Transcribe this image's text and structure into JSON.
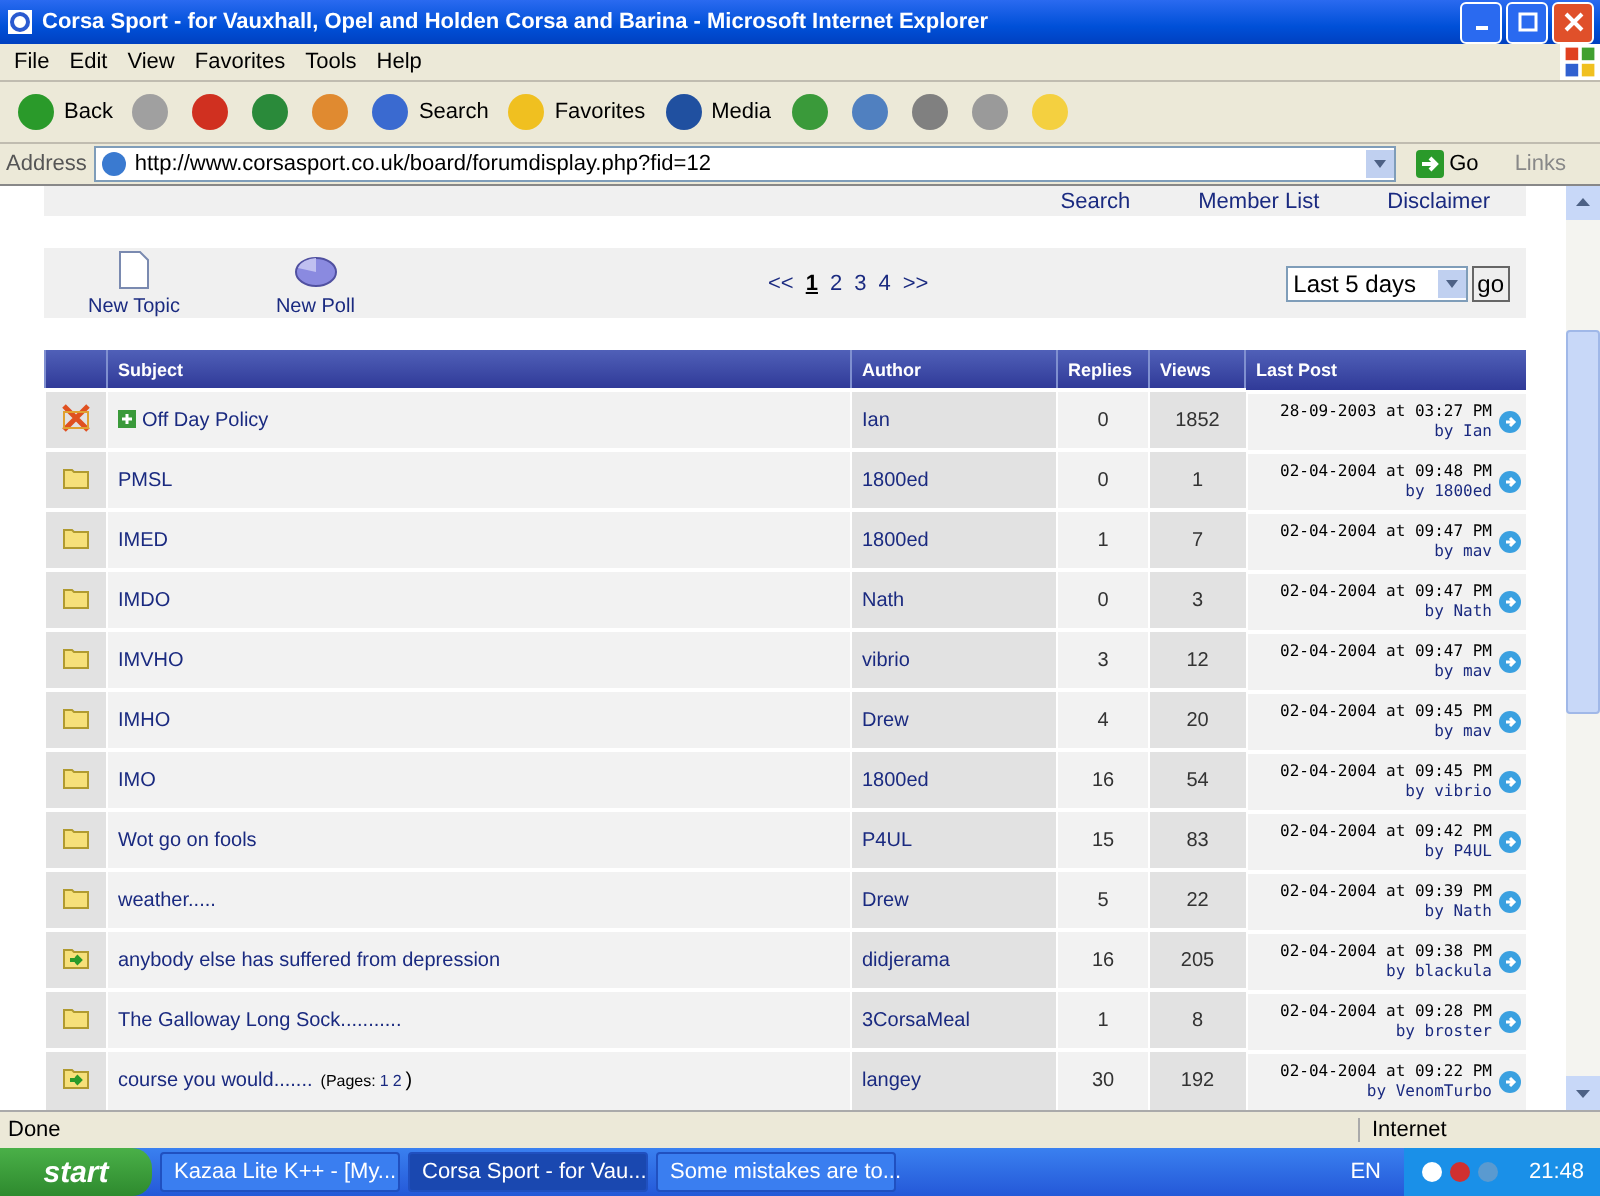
{
  "window": {
    "title": "Corsa Sport - for Vauxhall, Opel and Holden Corsa and Barina - Microsoft Internet Explorer"
  },
  "menu": [
    "File",
    "Edit",
    "View",
    "Favorites",
    "Tools",
    "Help"
  ],
  "toolbar": [
    {
      "kind": "back",
      "label": "Back"
    },
    {
      "kind": "forward"
    },
    {
      "kind": "stop"
    },
    {
      "kind": "refresh"
    },
    {
      "kind": "home"
    },
    {
      "kind": "search",
      "label": "Search"
    },
    {
      "kind": "favorites",
      "label": "Favorites"
    },
    {
      "kind": "media",
      "label": "Media"
    },
    {
      "kind": "history"
    },
    {
      "kind": "mail"
    },
    {
      "kind": "print"
    },
    {
      "kind": "edit"
    },
    {
      "kind": "note"
    }
  ],
  "address": {
    "label": "Address",
    "url": "http://www.corsasport.co.uk/board/forumdisplay.php?fid=12",
    "go": "Go",
    "links": "Links"
  },
  "top_links": [
    "Search",
    "Member List",
    "Disclaimer"
  ],
  "actions": [
    {
      "kind": "topic",
      "label": "New Topic"
    },
    {
      "kind": "poll",
      "label": "New Poll"
    }
  ],
  "pagination": {
    "prev": "<<",
    "next": ">>",
    "pages": [
      {
        "label": "1",
        "selected": true
      },
      {
        "label": "2",
        "selected": false
      },
      {
        "label": "3",
        "selected": false
      },
      {
        "label": "4",
        "selected": false
      }
    ]
  },
  "filter": {
    "value": "Last 5 days",
    "button": "go"
  },
  "table": {
    "columns": [
      "Subject",
      "Author",
      "Replies",
      "Views",
      "Last Post"
    ],
    "rows": [
      {
        "kind": "closed",
        "sticky": true,
        "subject": "Off Day Policy",
        "author": "Ian",
        "replies": "0",
        "views": "1852",
        "date": "28-09-2003 at 03:27 PM",
        "last_by": "by Ian"
      },
      {
        "kind": "normal",
        "sticky": false,
        "subject": "PMSL",
        "author": "1800ed",
        "replies": "0",
        "views": "1",
        "date": "02-04-2004 at 09:48 PM",
        "last_by": "by 1800ed"
      },
      {
        "kind": "normal",
        "sticky": false,
        "subject": "IMED",
        "author": "1800ed",
        "replies": "1",
        "views": "7",
        "date": "02-04-2004 at 09:47 PM",
        "last_by": "by mav"
      },
      {
        "kind": "normal",
        "sticky": false,
        "subject": "IMDO",
        "author": "Nath",
        "replies": "0",
        "views": "3",
        "date": "02-04-2004 at 09:47 PM",
        "last_by": "by Nath"
      },
      {
        "kind": "normal",
        "sticky": false,
        "subject": "IMVHO",
        "author": "vibrio",
        "replies": "3",
        "views": "12",
        "date": "02-04-2004 at 09:47 PM",
        "last_by": "by mav"
      },
      {
        "kind": "normal",
        "sticky": false,
        "subject": "IMHO",
        "author": "Drew",
        "replies": "4",
        "views": "20",
        "date": "02-04-2004 at 09:45 PM",
        "last_by": "by mav"
      },
      {
        "kind": "normal",
        "sticky": false,
        "subject": "IMO",
        "author": "1800ed",
        "replies": "16",
        "views": "54",
        "date": "02-04-2004 at 09:45 PM",
        "last_by": "by vibrio"
      },
      {
        "kind": "normal",
        "sticky": false,
        "subject": "Wot go on fools",
        "author": "P4UL",
        "replies": "15",
        "views": "83",
        "date": "02-04-2004 at 09:42 PM",
        "last_by": "by P4UL"
      },
      {
        "kind": "normal",
        "sticky": false,
        "subject": "weather.....",
        "author": "Drew",
        "replies": "5",
        "views": "22",
        "date": "02-04-2004 at 09:39 PM",
        "last_by": "by Nath"
      },
      {
        "kind": "moved",
        "sticky": false,
        "subject": "anybody else has suffered from depression",
        "author": "didjerama",
        "replies": "16",
        "views": "205",
        "date": "02-04-2004 at 09:38 PM",
        "last_by": "by blackula"
      },
      {
        "kind": "normal",
        "sticky": false,
        "subject": "The Galloway Long Sock...........",
        "author": "3CorsaMeal",
        "replies": "1",
        "views": "8",
        "date": "02-04-2004 at 09:28 PM",
        "last_by": "by broster"
      },
      {
        "kind": "moved",
        "sticky": false,
        "subject": "course you would.......",
        "pages_label": "(Pages:",
        "pages": [
          "1",
          "2"
        ],
        "pages_end": ")",
        "author": "langey",
        "replies": "30",
        "views": "192",
        "date": "02-04-2004 at 09:22 PM",
        "last_by": "by VenomTurbo"
      }
    ]
  },
  "status_bar": {
    "text": "Done",
    "zone": "Internet"
  },
  "taskbar": {
    "start": "start",
    "tasks": [
      {
        "label": "Kazaa Lite K++ - [My...",
        "selected": false
      },
      {
        "label": "Corsa Sport - for Vau...",
        "selected": true
      },
      {
        "label": "Some mistakes are to...",
        "selected": false
      }
    ],
    "lang": "EN",
    "clock": "21:48"
  }
}
